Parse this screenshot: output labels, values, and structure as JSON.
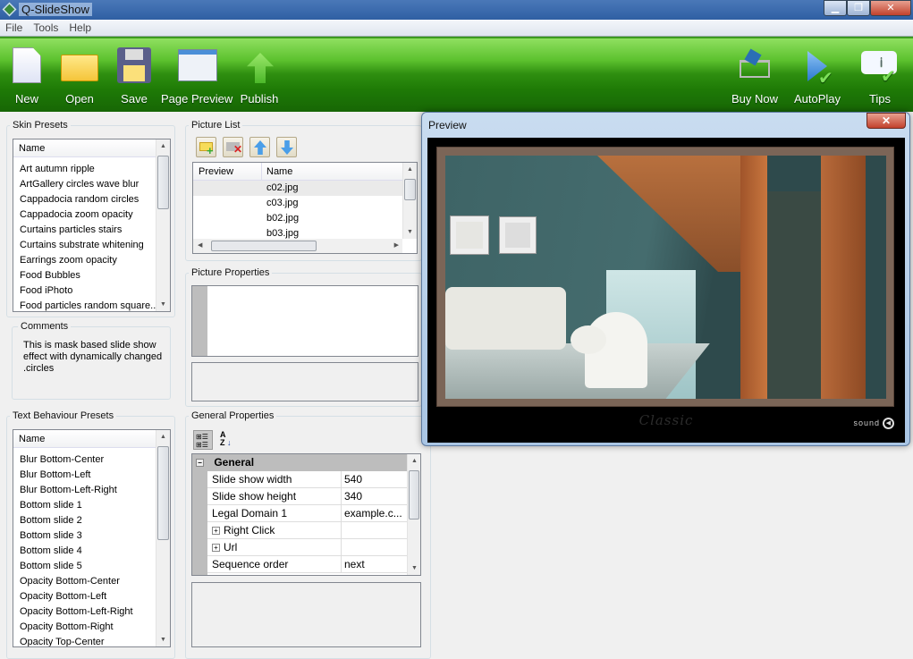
{
  "app": {
    "title": "Q-SlideShow"
  },
  "menu": [
    "File",
    "Tools",
    "Help"
  ],
  "toolbar": {
    "left": [
      {
        "label": "New",
        "icon": "new-document-icon"
      },
      {
        "label": "Open",
        "icon": "folder-icon"
      },
      {
        "label": "Save",
        "icon": "floppy-disk-icon"
      },
      {
        "label": "Page Preview",
        "icon": "page-preview-icon"
      },
      {
        "label": "Publish",
        "icon": "upload-arrow-icon"
      }
    ],
    "right": [
      {
        "label": "Buy Now",
        "icon": "shopping-cart-icon"
      },
      {
        "label": "AutoPlay",
        "icon": "play-icon"
      },
      {
        "label": "Tips",
        "icon": "tips-icon"
      }
    ]
  },
  "skin_presets": {
    "title": "Skin Presets",
    "column": "Name",
    "items": [
      "Art autumn ripple",
      "ArtGallery circles wave blur",
      "Cappadocia random circles",
      "Cappadocia zoom opacity",
      "Curtains particles stairs",
      "Curtains substrate whitening",
      "Earrings zoom opacity",
      "Food Bubbles",
      "Food iPhoto",
      "Food particles random square..."
    ]
  },
  "comments": {
    "title": "Comments",
    "text": "This is mask based slide show effect with dynamically changed .circles"
  },
  "text_presets": {
    "title": "Text Behaviour Presets",
    "column": "Name",
    "items": [
      "Blur Bottom-Center",
      "Blur Bottom-Left",
      "Blur Bottom-Left-Right",
      "Bottom slide 1",
      "Bottom slide 2",
      "Bottom slide 3",
      "Bottom slide 4",
      "Bottom slide 5",
      "Opacity Bottom-Center",
      "Opacity Bottom-Left",
      "Opacity Bottom-Left-Right",
      "Opacity Bottom-Right",
      "Opacity Top-Center"
    ]
  },
  "picture_list": {
    "title": "Picture List",
    "columns": [
      "Preview",
      "Name"
    ],
    "items": [
      "c02.jpg",
      "c03.jpg",
      "b02.jpg",
      "b03.jpg"
    ]
  },
  "picture_properties": {
    "title": "Picture Properties"
  },
  "general_properties": {
    "title": "General Properties",
    "category": "General",
    "rows": [
      {
        "key": "Slide show width",
        "value": "540"
      },
      {
        "key": "Slide show height",
        "value": "340"
      },
      {
        "key": "Legal Domain 1",
        "value": "example.c..."
      },
      {
        "key": "Right Click",
        "value": "",
        "expandable": true
      },
      {
        "key": "Url",
        "value": "",
        "expandable": true
      },
      {
        "key": "Sequence order",
        "value": "next"
      }
    ]
  },
  "preview": {
    "title": "Preview",
    "skin_label": "Classic",
    "sound_label": "sound"
  },
  "colors": {
    "toolbar_green": "#2f8f10",
    "title_blue": "#2f5fa3"
  }
}
